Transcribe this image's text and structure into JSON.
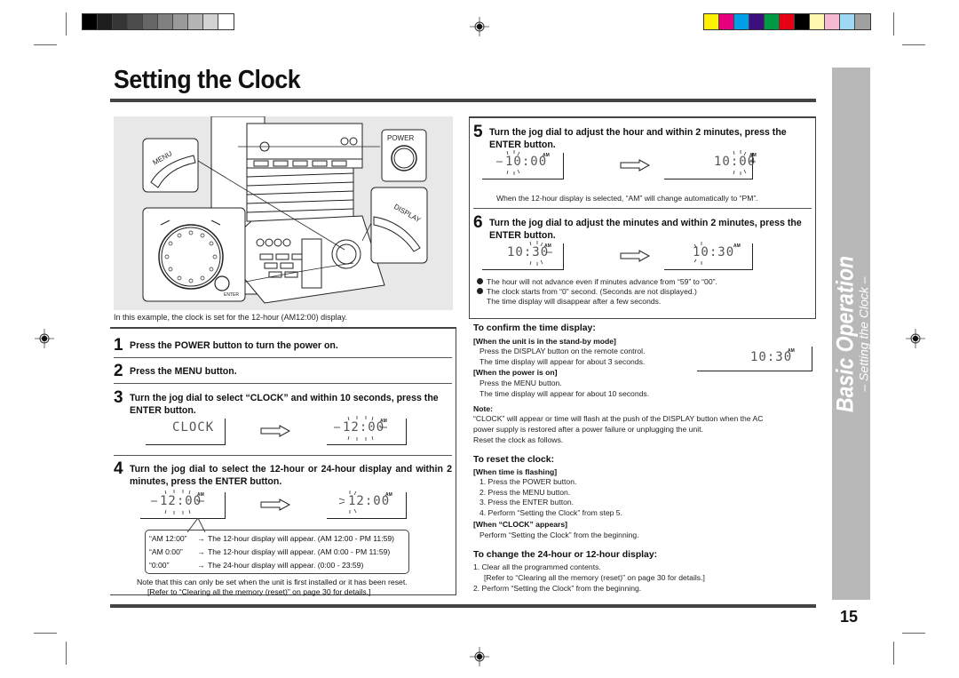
{
  "page": {
    "title": "Setting the Clock",
    "page_number": "15",
    "side_tab": {
      "section": "Basic Operation",
      "subsection": "– Setting the Clock –"
    },
    "print_marks": {
      "gray_swatches": [
        "#000000",
        "#1e1e1e",
        "#363636",
        "#4c4c4c",
        "#666666",
        "#808080",
        "#9a9a9a",
        "#b4b4b4",
        "#d2d2d2",
        "#ffffff"
      ],
      "color_swatches": [
        "#fff200",
        "#e6007e",
        "#00a0e9",
        "#3d0f7e",
        "#009944",
        "#e60012",
        "#000000",
        "#fff9b0",
        "#f7b9d2",
        "#9ed8f5",
        "#a0a0a0"
      ]
    }
  },
  "illustration": {
    "labels": {
      "menu": "MENU",
      "power": "POWER",
      "display": "DISPLAY",
      "enter": "ENTER"
    },
    "caption": "In this example, the clock is set for the 12-hour (AM12:00) display."
  },
  "steps": [
    {
      "num": "1",
      "text": "Press the POWER button to turn the power on."
    },
    {
      "num": "2",
      "text": "Press the MENU button."
    },
    {
      "num": "3",
      "text": "Turn the jog dial to select “CLOCK” and within 10 seconds, press the ENTER button.",
      "displays": [
        {
          "value": "CLOCK",
          "indicator": ""
        },
        {
          "value": "12:00",
          "indicator": "AM",
          "flashing": true
        }
      ]
    },
    {
      "num": "4",
      "text": "Turn the jog dial to select the 12-hour or 24-hour display and within 2 minutes, press the ENTER button.",
      "displays": [
        {
          "value": "12:00",
          "indicator": "AM",
          "flashing": true
        },
        {
          "value": "12:00",
          "indicator": "AM",
          "flashing": true
        }
      ],
      "options": [
        {
          "key": "“AM 12:00”",
          "arrow": "→",
          "desc": "The 12-hour display will appear. (AM 12:00 - PM 11:59)"
        },
        {
          "key": "“AM 0:00”",
          "arrow": "→",
          "desc": "The 12-hour display will appear. (AM 0:00 - PM 11:59)"
        },
        {
          "key": "“0:00”",
          "arrow": "→",
          "desc": "The 24-hour display will appear. (0:00 - 23:59)"
        }
      ],
      "note_1": "Note that this can only be set when the unit is first installed or it has been reset.",
      "note_2": "[Refer to “Clearing all the memory (reset)” on page 30 for details.]"
    },
    {
      "num": "5",
      "text": "Turn the jog dial to adjust the hour and within 2 minutes, press the ENTER button.",
      "displays": [
        {
          "value": "10:00",
          "indicator": "AM",
          "flashing": true
        },
        {
          "value": "10:00",
          "indicator": "AM",
          "flashing": true
        }
      ],
      "note": "When the 12-hour display is selected, “AM” will change automatically to “PM”."
    },
    {
      "num": "6",
      "text": "Turn the jog dial to adjust the minutes and within 2 minutes, press the ENTER button.",
      "displays": [
        {
          "value": "10:30",
          "indicator": "AM",
          "flashing": true
        },
        {
          "value": "10:30",
          "indicator": "AM",
          "flashing": true
        }
      ],
      "bullets": [
        "The hour will not advance even if minutes advance from “59” to “00”.",
        "The clock starts from “0” second. (Seconds are not displayed.)"
      ],
      "bullet_cont": "The time display will disappear after a few seconds."
    }
  ],
  "confirm": {
    "heading": "To confirm the time display:",
    "standby_label": "[When the unit is in the stand-by mode]",
    "standby_lines": [
      "Press the DISPLAY button on the remote control.",
      "The time display will appear for about 3 seconds."
    ],
    "power_label": "[When the power is on]",
    "power_lines": [
      "Press the MENU button.",
      "The time display will appear for about 10 seconds."
    ],
    "display": {
      "value": "10:30",
      "indicator": "AM"
    },
    "note_label": "Note:",
    "note_lines": [
      "“CLOCK” will appear or time will flash at the push of the DISPLAY button when the AC",
      "power supply is restored after a power failure or unplugging the unit.",
      "Reset the clock as follows."
    ]
  },
  "reset": {
    "heading": "To reset the clock:",
    "flashing_label": "[When time is flashing]",
    "flashing_steps": [
      "1. Press the POWER button.",
      "2. Press the MENU button.",
      "3. Press the ENTER button.",
      "4. Perform “Setting the Clock” from step 5."
    ],
    "clock_label": "[When “CLOCK” appears]",
    "clock_line": "Perform “Setting the Clock” from the beginning."
  },
  "change": {
    "heading": "To change the 24-hour or 12-hour display:",
    "lines": [
      "1. Clear all the programmed contents.",
      "[Refer to “Clearing all the memory (reset)” on page 30 for details.]",
      "2. Perform “Setting the Clock” from the beginning."
    ]
  }
}
